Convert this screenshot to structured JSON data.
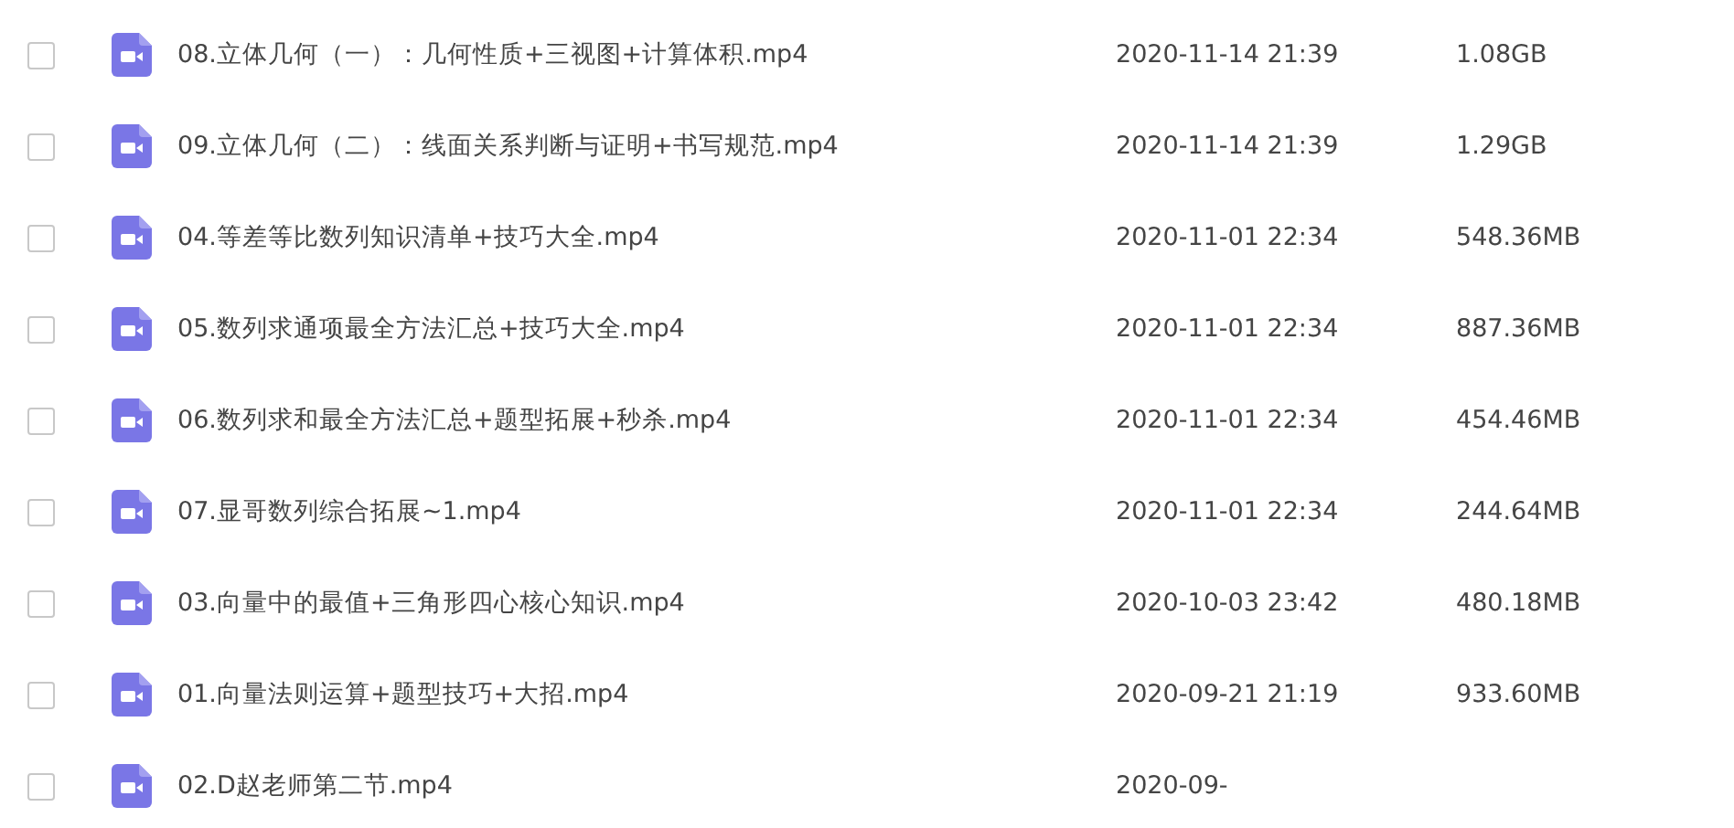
{
  "files": [
    {
      "name": "08.立体几何（一）：几何性质+三视图+计算体积.mp4",
      "date": "2020-11-14 21:39",
      "size": "1.08GB",
      "checked": false
    },
    {
      "name": "09.立体几何（二）：线面关系判断与证明+书写规范.mp4",
      "date": "2020-11-14 21:39",
      "size": "1.29GB",
      "checked": false
    },
    {
      "name": "04.等差等比数列知识清单+技巧大全.mp4",
      "date": "2020-11-01 22:34",
      "size": "548.36MB",
      "checked": false
    },
    {
      "name": "05.数列求通项最全方法汇总+技巧大全.mp4",
      "date": "2020-11-01 22:34",
      "size": "887.36MB",
      "checked": false
    },
    {
      "name": "06.数列求和最全方法汇总+题型拓展+秒杀.mp4",
      "date": "2020-11-01 22:34",
      "size": "454.46MB",
      "checked": false
    },
    {
      "name": "07.显哥数列综合拓展~1.mp4",
      "date": "2020-11-01 22:34",
      "size": "244.64MB",
      "checked": false
    },
    {
      "name": "03.向量中的最值+三角形四心核心知识.mp4",
      "date": "2020-10-03 23:42",
      "size": "480.18MB",
      "checked": false
    },
    {
      "name": "01.向量法则运算+题型技巧+大招.mp4",
      "date": "2020-09-21 21:19",
      "size": "933.60MB",
      "checked": false
    },
    {
      "name": "02.D赵老师第二节.mp4",
      "date": "2020-09-",
      "checked": false
    }
  ]
}
